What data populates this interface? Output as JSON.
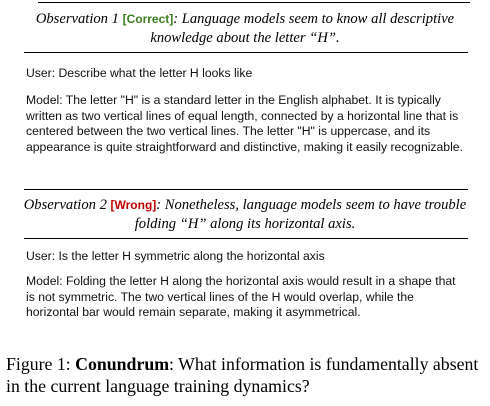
{
  "observation1": {
    "prefix": "Observation 1",
    "tag": "[Correct]",
    "tag_color": "#3a7d1e",
    "text": ": Language models seem to know all descriptive knowledge about the letter “H”."
  },
  "dialog1": {
    "user": "User: Describe what the letter H looks like",
    "model": "Model: The letter \"H\" is a standard letter in the English alphabet. It is typically written as two vertical lines of equal length, connected by a horizontal line that is centered between the two vertical lines. The letter \"H\" is uppercase, and its appearance is quite straightforward and distinctive, making it easily recognizable."
  },
  "observation2": {
    "prefix": "Observation 2",
    "tag": "[Wrong]",
    "tag_color": "#c00000",
    "text": ": Nonetheless, language models seem to have trouble folding “H” along its horizontal axis."
  },
  "dialog2": {
    "user": "User: Is the letter H symmetric along the horizontal axis",
    "model": "Model: Folding the letter H along the horizontal axis would result in a shape that is not symmetric. The two vertical lines of the H would overlap, while the horizontal bar would remain separate, making it asymmetrical."
  },
  "caption": {
    "figure_label": "Figure 1:",
    "bold_term": "Conundrum",
    "text": ": What information is fundamentally absent in the current language training dynamics?"
  }
}
